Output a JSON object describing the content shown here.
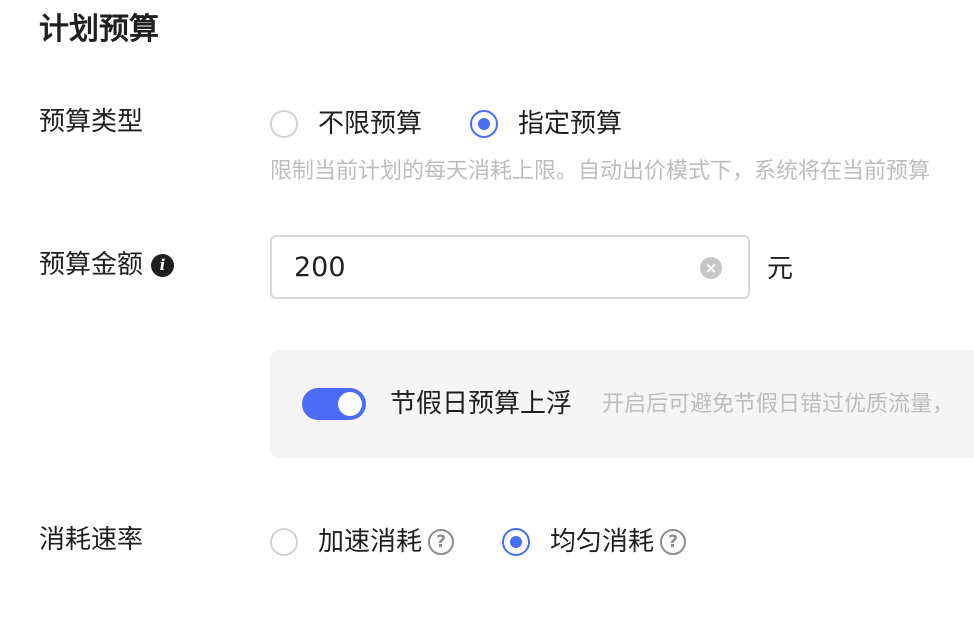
{
  "section_title": "计划预算",
  "budget_type": {
    "label": "预算类型",
    "options": [
      {
        "label": "不限预算",
        "checked": false
      },
      {
        "label": "指定预算",
        "checked": true
      }
    ],
    "hint": "限制当前计划的每天消耗上限。自动出价模式下，系统将在当前预算"
  },
  "budget_amount": {
    "label": "预算金额",
    "info_icon": "info-icon",
    "value": "200",
    "clear_icon": "clear-icon",
    "unit": "元"
  },
  "holiday_float": {
    "enabled": true,
    "label": "节假日预算上浮",
    "hint": "开启后可避免节假日错过优质流量，"
  },
  "spend_rate": {
    "label": "消耗速率",
    "options": [
      {
        "label": "加速消耗",
        "checked": false,
        "help_icon": "help-icon"
      },
      {
        "label": "均匀消耗",
        "checked": true,
        "help_icon": "help-icon"
      }
    ]
  },
  "colors": {
    "accent": "#4a6cf7",
    "hint_text": "#bdbdbd",
    "panel_bg": "#f5f5f6"
  }
}
